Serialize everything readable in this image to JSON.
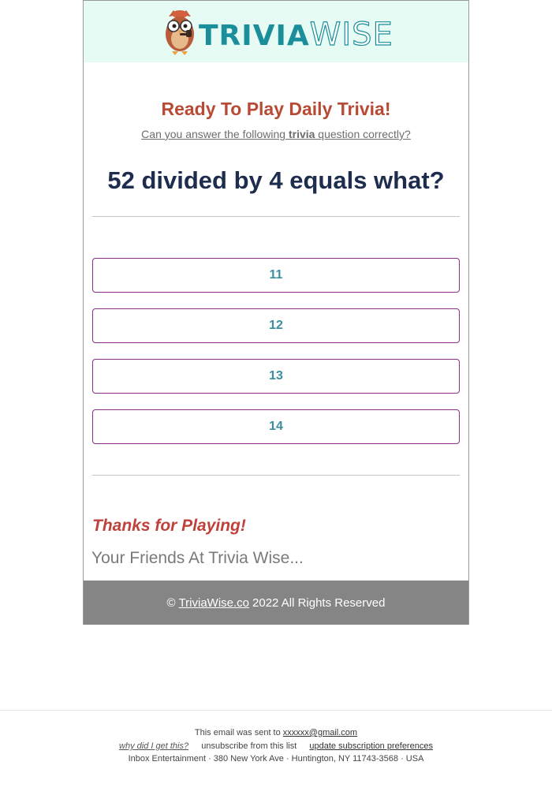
{
  "header": {
    "logo_word_1": "Trivia",
    "logo_word_2": "Wise",
    "mascot_icon": "owl-with-pipe-icon",
    "background_color": "#e6fbf3"
  },
  "main": {
    "headline": "Ready To Play Daily Trivia!",
    "subline_before": "Can you answer the following ",
    "subline_bold": "trivia",
    "subline_after": " question correctly?",
    "question": "52 divided by 4 equals what?"
  },
  "answers": [
    {
      "label": "11"
    },
    {
      "label": "12"
    },
    {
      "label": "13"
    },
    {
      "label": "14"
    }
  ],
  "signoff": {
    "thanks": "Thanks for Playing!",
    "friends": "Your Friends At Trivia Wise..."
  },
  "footer": {
    "copyright_symbol": "©",
    "site_link": "TriviaWise.co",
    "rights": "2022 All Rights Reserved"
  },
  "legal": {
    "sent_to_prefix": "This email was sent to",
    "email": "xxxxxx@gmail.com",
    "why_link": "why did I get this?",
    "unsubscribe": "unsubscribe from this list",
    "preferences_link": "update subscription preferences",
    "address": "Inbox Entertainment · 380 New York Ave · Huntington, NY 11743-3568 · USA"
  },
  "colors": {
    "headline": "#b84a35",
    "question": "#1e2c4e",
    "answer_border": "#8a2e8a",
    "answer_text": "#3b8ea0",
    "thanks": "#c0413a",
    "footer_bg": "#858585",
    "brand_teal": "#1a8f9b"
  }
}
